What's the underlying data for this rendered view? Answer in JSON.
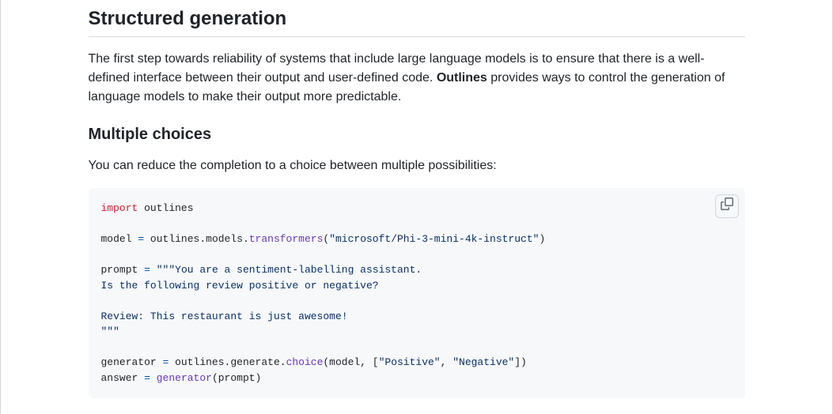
{
  "section": {
    "title": "Structured generation",
    "intro_pre": "The first step towards reliability of systems that include large language models is to ensure that there is a well-defined interface between their output and user-defined code. ",
    "intro_bold": "Outlines",
    "intro_post": " provides ways to control the generation of language models to make their output more predictable."
  },
  "subsection": {
    "title": "Multiple choices",
    "intro": "You can reduce the completion to a choice between multiple possibilities:"
  },
  "code": {
    "import_kw": "import",
    "import_mod": " outlines",
    "l_model_a": "model ",
    "eq": "=",
    "l_model_b": " outlines.models.",
    "l_model_fn": "transformers",
    "l_model_c": "(",
    "l_model_str": "\"microsoft/Phi-3-mini-4k-instruct\"",
    "l_model_d": ")",
    "l_prompt_a": "prompt ",
    "l_prompt_b": " ",
    "l_prompt_str1": "\"\"\"You are a sentiment-labelling assistant.",
    "l_prompt_str2": "Is the following review positive or negative?",
    "l_prompt_str3": "Review: This restaurant is just awesome!",
    "l_prompt_str4": "\"\"\"",
    "l_gen_a": "generator ",
    "l_gen_b": " outlines.generate.",
    "l_gen_fn": "choice",
    "l_gen_c": "(model, [",
    "l_gen_s1": "\"Positive\"",
    "l_gen_d": ", ",
    "l_gen_s2": "\"Negative\"",
    "l_gen_e": "])",
    "l_ans_a": "answer ",
    "l_ans_b": " ",
    "l_ans_fn": "generator",
    "l_ans_c": "(prompt)"
  }
}
